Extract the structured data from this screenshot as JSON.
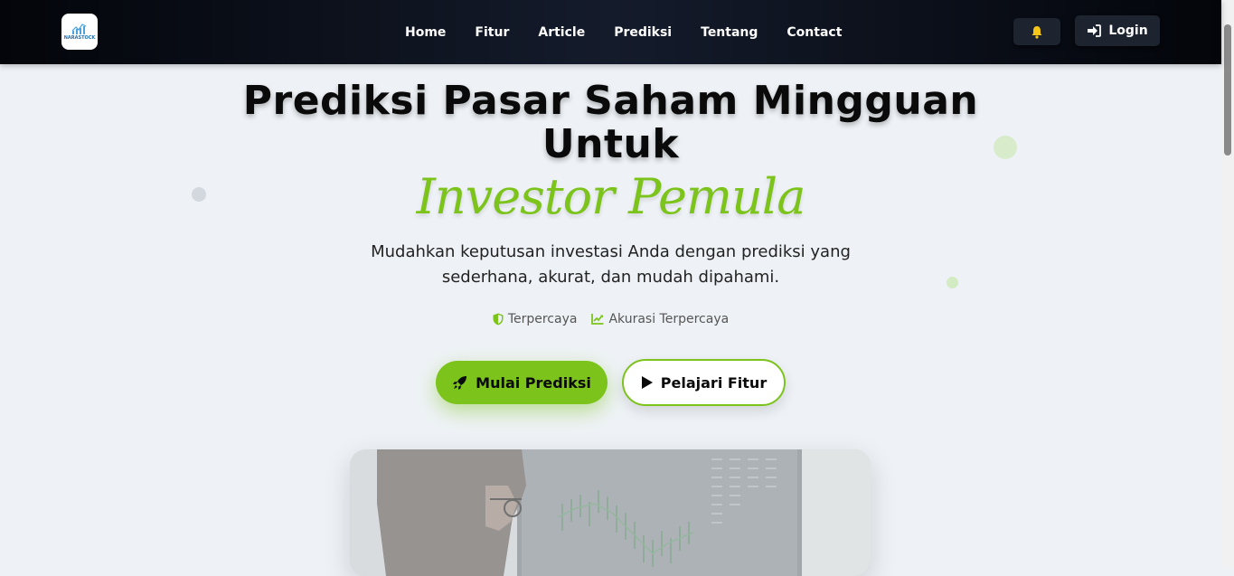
{
  "brand": {
    "logo_text": "NARASTOCK",
    "logo_icon": "chart-logo-icon"
  },
  "nav": {
    "links": [
      "Home",
      "Fitur",
      "Article",
      "Prediksi",
      "Tentang",
      "Contact"
    ],
    "notification_icon": "bell-icon",
    "login_label": "Login",
    "login_icon": "sign-in-icon"
  },
  "hero": {
    "title_line1": "Prediksi Pasar Saham Mingguan",
    "title_line2": "Untuk",
    "accent": "Investor Pemula",
    "subtitle": "Mudahkan keputusan investasi Anda dengan prediksi yang sederhana, akurat, dan mudah dipahami.",
    "badges": [
      {
        "icon": "shield-icon",
        "label": "Terpercaya"
      },
      {
        "icon": "chart-line-icon",
        "label": "Akurasi Terpercaya"
      }
    ],
    "primary_button": {
      "label": "Mulai Prediksi",
      "icon": "rocket-icon"
    },
    "secondary_button": {
      "label": "Pelajari Fitur",
      "icon": "play-icon"
    }
  },
  "colors": {
    "accent": "#7cc31c",
    "navbar_bg": "#0b0f18",
    "page_bg": "#eef2f6",
    "bell": "#f5c518"
  }
}
